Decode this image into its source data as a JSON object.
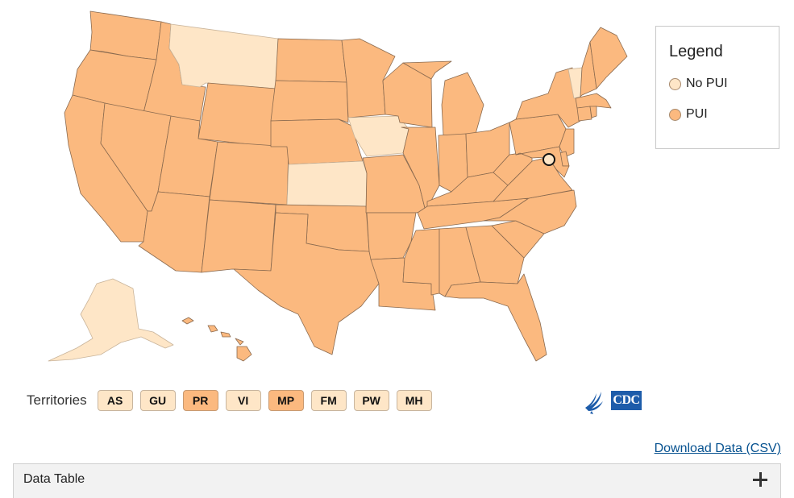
{
  "legend": {
    "title": "Legend",
    "items": [
      {
        "label": "No PUI",
        "color": "#fee6c7"
      },
      {
        "label": "PUI",
        "color": "#fbb97f"
      }
    ]
  },
  "colors": {
    "no_pui": "#fee6c7",
    "pui": "#fbb97f",
    "link": "#075290",
    "cdc_blue": "#1d5caa"
  },
  "states": {
    "no_pui": [
      "MT",
      "IA",
      "KS",
      "VT",
      "AK",
      "DC"
    ],
    "pui": [
      "WA",
      "OR",
      "CA",
      "ID",
      "NV",
      "UT",
      "AZ",
      "WY",
      "CO",
      "NM",
      "ND",
      "SD",
      "NE",
      "OK",
      "TX",
      "MN",
      "MO",
      "AR",
      "LA",
      "WI",
      "IL",
      "MI",
      "IN",
      "OH",
      "KY",
      "TN",
      "MS",
      "AL",
      "GA",
      "FL",
      "SC",
      "NC",
      "VA",
      "WV",
      "PA",
      "NY",
      "NJ",
      "DE",
      "MD",
      "CT",
      "RI",
      "MA",
      "NH",
      "ME",
      "HI"
    ]
  },
  "territories": {
    "label": "Territories",
    "items": [
      {
        "code": "AS",
        "status": "nopui"
      },
      {
        "code": "GU",
        "status": "nopui"
      },
      {
        "code": "PR",
        "status": "pui"
      },
      {
        "code": "VI",
        "status": "nopui"
      },
      {
        "code": "MP",
        "status": "pui"
      },
      {
        "code": "FM",
        "status": "nopui"
      },
      {
        "code": "PW",
        "status": "nopui"
      },
      {
        "code": "MH",
        "status": "nopui"
      }
    ]
  },
  "logos": {
    "cdc_text": "CDC"
  },
  "download_link": "Download Data (CSV)",
  "data_table": {
    "label": "Data Table"
  }
}
